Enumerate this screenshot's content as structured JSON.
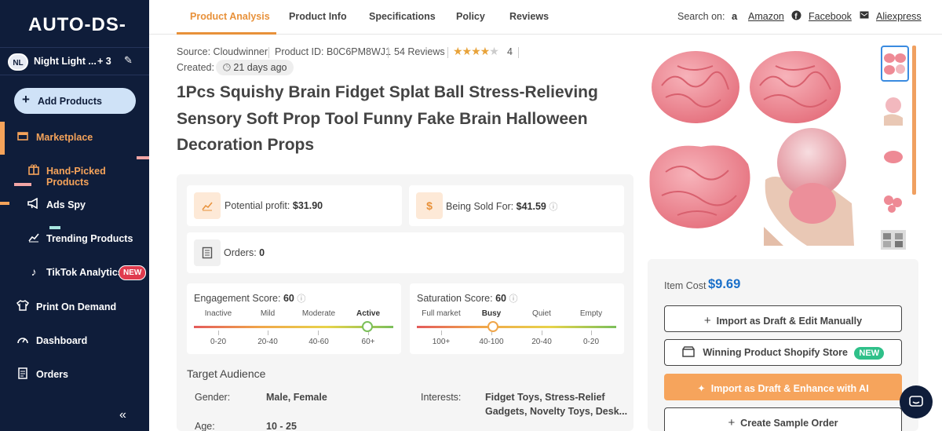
{
  "sidebar": {
    "logo": "AUTO-DS-",
    "store": {
      "avatar": "NL",
      "name": "Night Light ...",
      "count": "+ 3",
      "edit_icon": "pencil-icon"
    },
    "add_button": {
      "icon": "+",
      "label": "Add Products"
    },
    "items": [
      {
        "label": "Marketplace",
        "icon": "store-icon"
      },
      {
        "label": "Hand-Picked Products",
        "icon": "gift-icon"
      },
      {
        "label": "Ads Spy",
        "icon": "megaphone-icon"
      },
      {
        "label": "Trending Products",
        "icon": "trend-icon"
      },
      {
        "label": "TikTok Analytics",
        "icon": "tiktok-icon",
        "badge": "NEW"
      },
      {
        "label": "Print On Demand",
        "icon": "shirt-icon"
      },
      {
        "label": "Dashboard",
        "icon": "gauge-icon"
      },
      {
        "label": "Orders",
        "icon": "receipt-icon"
      }
    ],
    "collapse_icon": "«"
  },
  "tabs": [
    "Product Analysis",
    "Product Info",
    "Specifications",
    "Policy",
    "Reviews"
  ],
  "search_on": {
    "label": "Search on:",
    "links": [
      "Amazon",
      "Facebook",
      "Aliexpress"
    ]
  },
  "product": {
    "source": "Source: Cloudwinner",
    "product_id": "Product ID: B0C6PM8WJ1",
    "reviews": "54 Reviews",
    "rating": "4",
    "rating_value": 4,
    "created_label": "Created:",
    "created_value": "21 days ago",
    "title": "1Pcs Squishy Brain Fidget Splat Ball Stress-Relieving Sensory Soft Prop Tool Funny Fake Brain Halloween Decoration Props"
  },
  "metrics": {
    "potential_profit_label": "Potential profit:",
    "potential_profit": "$31.90",
    "sold_for_label": "Being Sold For:",
    "sold_for": "$41.59",
    "orders_label": "Orders:",
    "orders": "0"
  },
  "engagement": {
    "title": "Engagement Score:",
    "score": "60",
    "levels": [
      "Inactive",
      "Mild",
      "Moderate",
      "Active"
    ],
    "ranges": [
      "0-20",
      "20-40",
      "40-60",
      "60+"
    ],
    "active_index": 3,
    "level": 0.87
  },
  "saturation": {
    "title": "Saturation Score:",
    "score": "60",
    "levels": [
      "Full market",
      "Busy",
      "Quiet",
      "Empty"
    ],
    "ranges": [
      "100+",
      "40-100",
      "20-40",
      "0-20"
    ],
    "active_index": 1,
    "level": 0.38
  },
  "audience": {
    "title": "Target Audience",
    "gender_label": "Gender:",
    "gender": "Male, Female",
    "interests_label": "Interests:",
    "interests_1": "Fidget Toys, Stress-Relief",
    "interests_2": "Gadgets, Novelty Toys, Desk...",
    "age_label": "Age:",
    "age": "10 - 25"
  },
  "purchase": {
    "item_cost_label": "Item Cost",
    "item_cost": "$9.69",
    "import_manual": "Import as Draft & Edit Manually",
    "winning_store": "Winning Product Shopify Store",
    "winning_badge": "NEW",
    "import_ai": "Import as Draft & Enhance with AI",
    "sample_order": "Create Sample Order"
  },
  "colors": {
    "accent": "#e8913a",
    "sidebar": "#0f1d3a",
    "link_blue": "#1a6fc9",
    "brain_pink": "#ee8a95"
  }
}
